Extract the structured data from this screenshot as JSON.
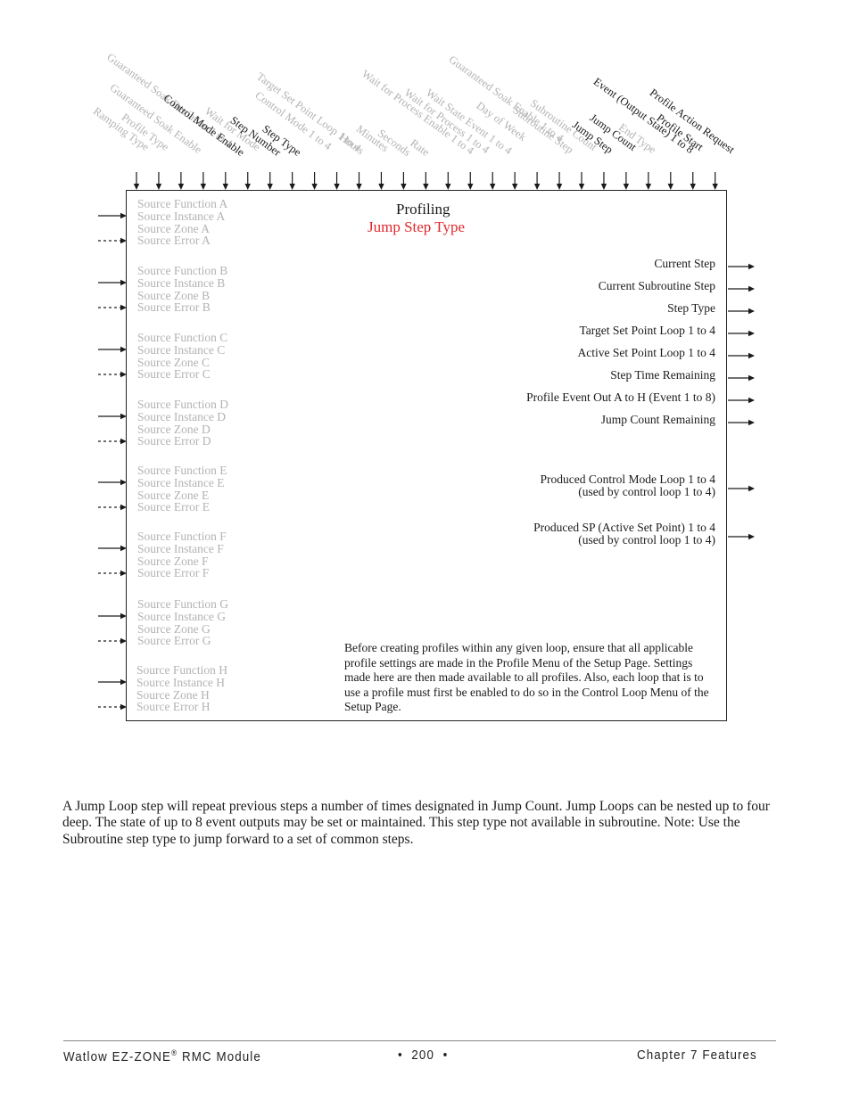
{
  "diagram": {
    "title": "Profiling",
    "subtitle": "Jump Step Type",
    "colors": {
      "active_text": "#1a1a1a",
      "inactive_text": "#b3b3b3",
      "subtitle": "#e0282d"
    },
    "top_inputs": [
      {
        "label": "Ramping Type",
        "active": false
      },
      {
        "label": "Profile Type",
        "active": false
      },
      {
        "label": "Guaranteed Soak Enable",
        "active": false
      },
      {
        "label": "Guaranteed Soak Deviation 1 to 4",
        "active": false
      },
      {
        "label": "Control Mode Enable",
        "active": true
      },
      {
        "label": "Wait for Mode",
        "active": false
      },
      {
        "label": "Step Number",
        "active": true
      },
      {
        "label": "Step Type",
        "active": true
      },
      {
        "label": "Control Mode 1 to 4",
        "active": false
      },
      {
        "label": "Target Set Point Loop 1 to 4",
        "active": false
      },
      {
        "label": "Hours",
        "active": false
      },
      {
        "label": "Minutes",
        "active": false
      },
      {
        "label": "Seconds",
        "active": false
      },
      {
        "label": "Rate",
        "active": false
      },
      {
        "label": "Wait for Process Enable 1 to 4",
        "active": false
      },
      {
        "label": "Wait for Process 1 to 4",
        "active": false
      },
      {
        "label": "Wait State Event 1 to 4",
        "active": false
      },
      {
        "label": "Day of Week",
        "active": false
      },
      {
        "label": "Guaranteed Soak Enable 1 to 4",
        "active": false
      },
      {
        "label": "Subroutine Step",
        "active": false
      },
      {
        "label": "Subroutine Count",
        "active": false
      },
      {
        "label": "Jump Step",
        "active": true
      },
      {
        "label": "Jump Count",
        "active": true
      },
      {
        "label": "End Type",
        "active": false
      },
      {
        "label": "Event (Output State) 1 to 8",
        "active": true
      },
      {
        "label": "Profile Start",
        "active": true
      },
      {
        "label": "Profile Action Request",
        "active": true
      }
    ],
    "source_groups": [
      {
        "letter": "A",
        "lines": [
          "Source Function A",
          "Source Instance A",
          "Source Zone A",
          "Source Error A"
        ]
      },
      {
        "letter": "B",
        "lines": [
          "Source Function B",
          "Source Instance B",
          "Source Zone B",
          "Source Error B"
        ]
      },
      {
        "letter": "C",
        "lines": [
          "Source Function C",
          "Source Instance C",
          "Source Zone C",
          "Source Error C"
        ]
      },
      {
        "letter": "D",
        "lines": [
          "Source Function D",
          "Source Instance D",
          "Source Zone D",
          "Source Error D"
        ]
      },
      {
        "letter": "E",
        "lines": [
          "Source Function E",
          "Source Instance E",
          "Source Zone E",
          "Source Error E"
        ]
      },
      {
        "letter": "F",
        "lines": [
          "Source Function F",
          "Source Instance F",
          "Source Zone F",
          "Source Error F"
        ]
      },
      {
        "letter": "G",
        "lines": [
          "Source Function G",
          "Source Instance G",
          "Source Zone G",
          "Source Error G"
        ]
      },
      {
        "letter": "H",
        "lines": [
          "Source Function H",
          "Source Instance H",
          "Source Zone H",
          "Source Error H"
        ]
      }
    ],
    "outputs": [
      "Current Step",
      "Current Subroutine Step",
      "Step Type",
      "Target Set Point Loop 1 to 4",
      "Active Set Point Loop 1 to 4",
      "Step Time Remaining",
      "Profile Event Out A to H (Event 1 to 8)",
      "Jump Count Remaining"
    ],
    "produced_outputs": [
      {
        "line1": "Produced Control Mode Loop 1 to 4",
        "line2": "(used by control loop 1 to 4)"
      },
      {
        "line1": "Produced SP (Active Set Point) 1 to 4",
        "line2": "(used by control loop 1 to 4)"
      }
    ],
    "note": "Before creating profiles within any given loop, ensure that all applicable profile settings are made in the Profile Menu of the Setup Page. Settings made here are then made available to all profiles. Also, each loop that is to use a profile must first be enabled to do so in the Control Loop Menu of the Setup Page."
  },
  "body_text": "A Jump Loop step will repeat previous steps a number of times designated in Jump Count. Jump Loops can be nested up to four deep. The state of up to 8 event outputs may be set or maintained. This step type not available in subroutine. Note: Use the Subroutine step type to jump forward to a set of common steps.",
  "footer": {
    "product_prefix": "Watlow EZ-ZONE",
    "registered_mark": "®",
    "product_suffix": " RMC Module",
    "page": "•  200  •",
    "chapter": "Chapter 7 Features"
  }
}
